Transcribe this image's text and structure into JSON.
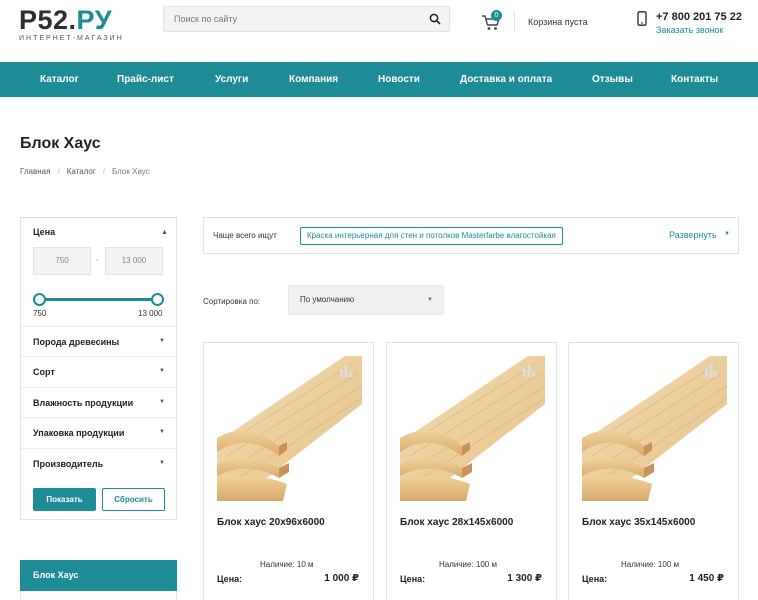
{
  "header": {
    "logo": {
      "main": "Р52.",
      "accent": "РУ",
      "subtitle": "ИНТЕРНЕТ-МАГАЗИН"
    },
    "search": {
      "placeholder": "Поиск по сайту",
      "value": ""
    },
    "cart": {
      "count": "0",
      "text": "Корзина пуста"
    },
    "phone": {
      "number": "+7 800 201 75 22",
      "callback": "Заказать звонок"
    }
  },
  "nav": {
    "items": [
      {
        "label": "Каталог"
      },
      {
        "label": "Прайс-лист"
      },
      {
        "label": "Услуги"
      },
      {
        "label": "Компания"
      },
      {
        "label": "Новости"
      },
      {
        "label": "Доставка и оплата"
      },
      {
        "label": "Отзывы"
      },
      {
        "label": "Контакты"
      }
    ]
  },
  "page": {
    "title": "Блок Хаус",
    "breadcrumbs": [
      "Главная",
      "Каталог",
      "Блок Хаус"
    ]
  },
  "filter": {
    "price_title": "Цена",
    "price_min": "750",
    "price_max": "13 000",
    "slider_min_label": "750",
    "slider_max_label": "13 000",
    "sections": [
      {
        "label": "Порода древесины"
      },
      {
        "label": "Сорт"
      },
      {
        "label": "Влажность продукции"
      },
      {
        "label": "Упаковка продукции"
      },
      {
        "label": "Производитель"
      }
    ],
    "show_button": "Показать",
    "reset_button": "Сбросить"
  },
  "sidebar_category": {
    "label": "Блок Хаус"
  },
  "often_searched": {
    "label": "Чаще всего ищут",
    "tag": "Краска интерьерная для стен и потолков Masterfarbe влагостойкая",
    "expand": "Развернуть"
  },
  "sort": {
    "label": "Сортировка по:",
    "selected": "По умолчанию"
  },
  "products": [
    {
      "name": "Блок хаус 20х96х6000",
      "availability": "Наличие: 10 м",
      "price_label": "Цена:",
      "price": "1 000 ₽"
    },
    {
      "name": "Блок хаус 28х145х6000",
      "availability": "Наличие: 100 м",
      "price_label": "Цена:",
      "price": "1 300 ₽"
    },
    {
      "name": "Блок хаус 35х145х6000",
      "availability": "Наличие: 100 м",
      "price_label": "Цена:",
      "price": "1 450 ₽"
    }
  ],
  "colors": {
    "accent": "#1e8c96",
    "text": "#222222",
    "border": "#e2e2e2"
  }
}
